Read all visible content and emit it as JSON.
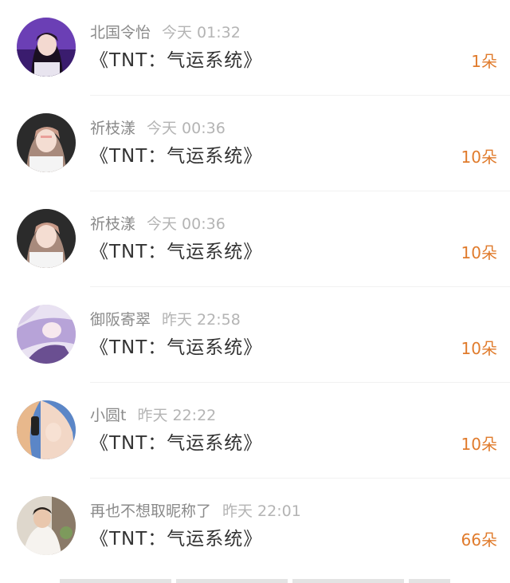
{
  "gifts": [
    {
      "name": "北国令怡",
      "time": "今天 01:32",
      "title": "《TNT：气运系统》",
      "count": "1朵"
    },
    {
      "name": "祈枝漾",
      "time": "今天 00:36",
      "title": "《TNT：气运系统》",
      "count": "10朵"
    },
    {
      "name": "祈枝漾",
      "time": "今天 00:36",
      "title": "《TNT：气运系统》",
      "count": "10朵"
    },
    {
      "name": "御阪寄翠",
      "time": "昨天 22:58",
      "title": "《TNT：气运系统》",
      "count": "10朵"
    },
    {
      "name": "小圆t",
      "time": "昨天 22:22",
      "title": "《TNT：气运系统》",
      "count": "10朵"
    },
    {
      "name": "再也不想取昵称了",
      "time": "昨天 22:01",
      "title": "《TNT：气运系统》",
      "count": "66朵"
    }
  ],
  "colors": {
    "accent": "#e07b2c",
    "name": "#8a8a8a",
    "time": "#b4b4b4",
    "title": "#333333"
  }
}
